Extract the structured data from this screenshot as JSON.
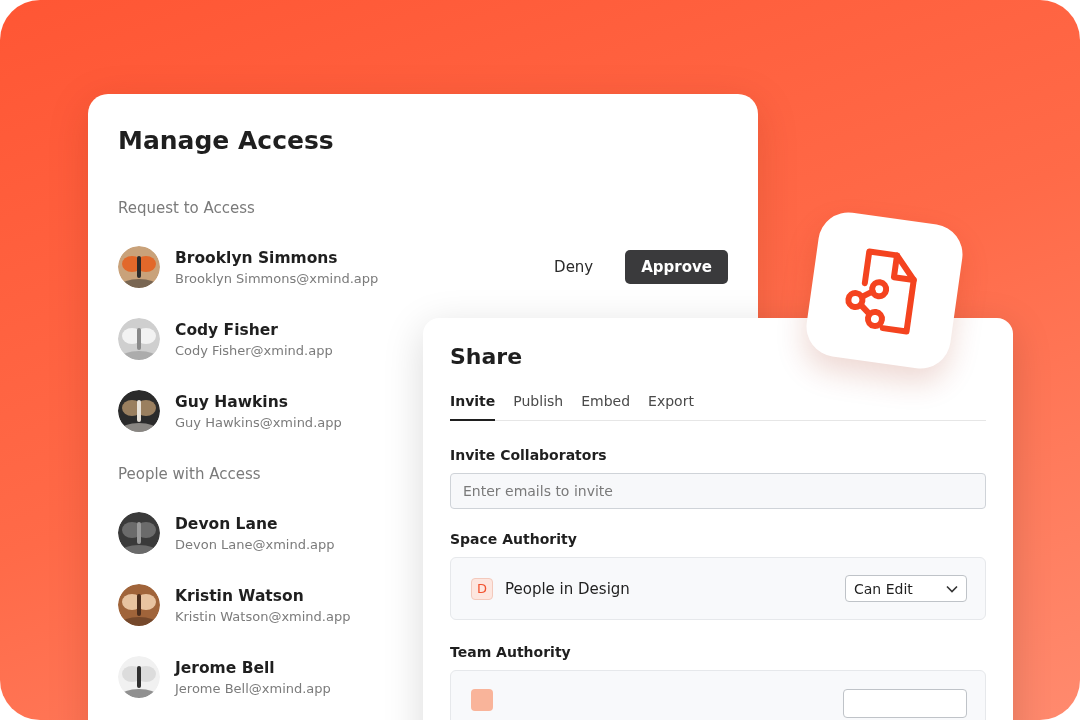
{
  "manage_access": {
    "title": "Manage Access",
    "sections": [
      {
        "title": "Request to Access",
        "people": [
          {
            "name": "Brooklyn Simmons",
            "email": "Brooklyn Simmons@xmind.app",
            "actions": [
              {
                "label": "Deny",
                "kind": "secondary"
              },
              {
                "label": "Approve",
                "kind": "primary"
              }
            ]
          },
          {
            "name": "Cody Fisher",
            "email": "Cody Fisher@xmind.app"
          },
          {
            "name": "Guy Hawkins",
            "email": "Guy Hawkins@xmind.app"
          }
        ]
      },
      {
        "title": "People with Access",
        "people": [
          {
            "name": "Devon Lane",
            "email": "Devon Lane@xmind.app"
          },
          {
            "name": "Kristin Watson",
            "email": "Kristin Watson@xmind.app"
          },
          {
            "name": "Jerome Bell",
            "email": "Jerome Bell@xmind.app"
          }
        ]
      }
    ]
  },
  "share": {
    "title": "Share",
    "tabs": [
      {
        "label": "Invite",
        "selected": true
      },
      {
        "label": "Publish",
        "selected": false
      },
      {
        "label": "Embed",
        "selected": false
      },
      {
        "label": "Export",
        "selected": false
      }
    ],
    "invite": {
      "label": "Invite Collaborators",
      "placeholder": "Enter emails to invite"
    },
    "space_authority": {
      "label": "Space Authority",
      "badge": "D",
      "group": "People in Design",
      "permission": "Can Edit"
    },
    "team_authority": {
      "label": "Team Authority"
    }
  }
}
